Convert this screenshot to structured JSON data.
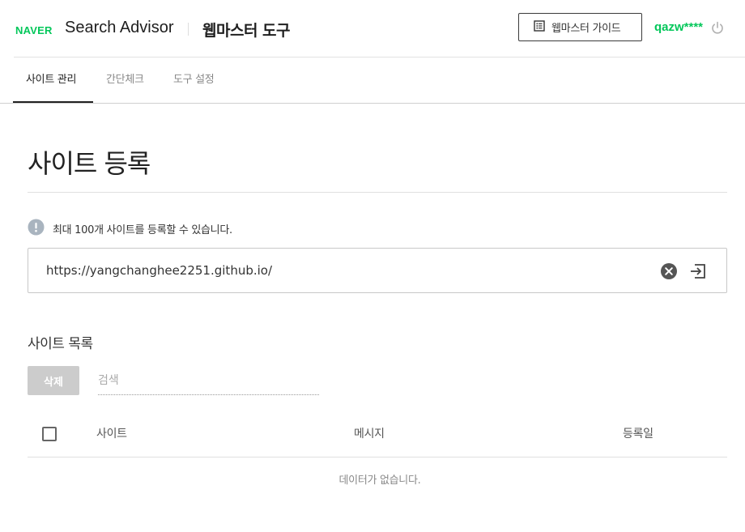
{
  "brand": {
    "logo_text": "NAVER",
    "app_name": "Search Advisor",
    "tool_title": "웹마스터 도구",
    "brand_color": "#03c75a"
  },
  "header": {
    "guide_button_label": "웹마스터 가이드",
    "guide_icon": "document-list-icon",
    "user_name": "qazw****",
    "logout_icon": "power-icon"
  },
  "tabs": [
    {
      "label": "사이트 관리",
      "active": true
    },
    {
      "label": "간단체크",
      "active": false
    },
    {
      "label": "도구 설정",
      "active": false
    }
  ],
  "page": {
    "title": "사이트 등록",
    "info_icon": "exclamation-circle-icon",
    "info_message": "최대 100개 사이트를 등록할 수 있습니다.",
    "url_value": "https://yangchanghee2251.github.io/",
    "clear_icon": "clear-circle-icon",
    "submit_icon": "enter-arrow-icon"
  },
  "site_list": {
    "title": "사이트 목록",
    "delete_label": "삭제",
    "search_placeholder": "검색",
    "columns": [
      "사이트",
      "메시지",
      "등록일"
    ],
    "rows": [],
    "empty_message": "데이터가 없습니다."
  }
}
